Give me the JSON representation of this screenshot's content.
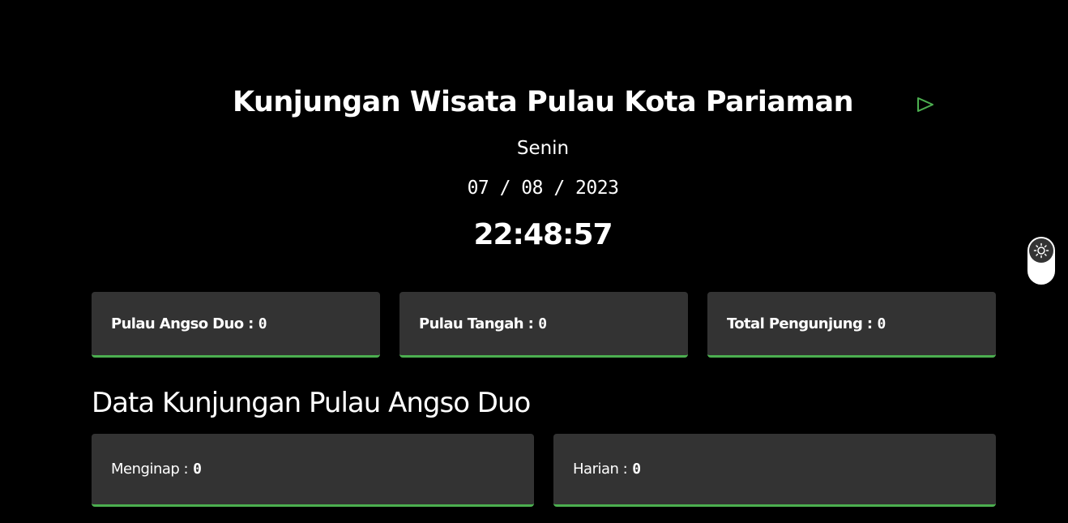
{
  "header": {
    "title": "Kunjungan Wisata Pulau Kota Pariaman",
    "day": "Senin",
    "date": "07 / 08 / 2023",
    "time": "22:48:57",
    "play_icon": "play-triangle-icon"
  },
  "stats": [
    {
      "label": "Pulau Angso Duo :",
      "value": "0"
    },
    {
      "label": "Pulau Tangah :",
      "value": "0"
    },
    {
      "label": "Total Pengunjung :",
      "value": "0"
    }
  ],
  "section": {
    "title": "Data Kunjungan Pulau Angso Duo",
    "items": [
      {
        "label": "Menginap :",
        "value": "0"
      },
      {
        "label": "Harian :",
        "value": "0"
      }
    ]
  },
  "theme_toggle": {
    "icon": "sun-icon"
  },
  "colors": {
    "background": "#000000",
    "card": "#333333",
    "accent": "#4caf50",
    "play_icon": "#4caf50",
    "text": "#ffffff"
  }
}
